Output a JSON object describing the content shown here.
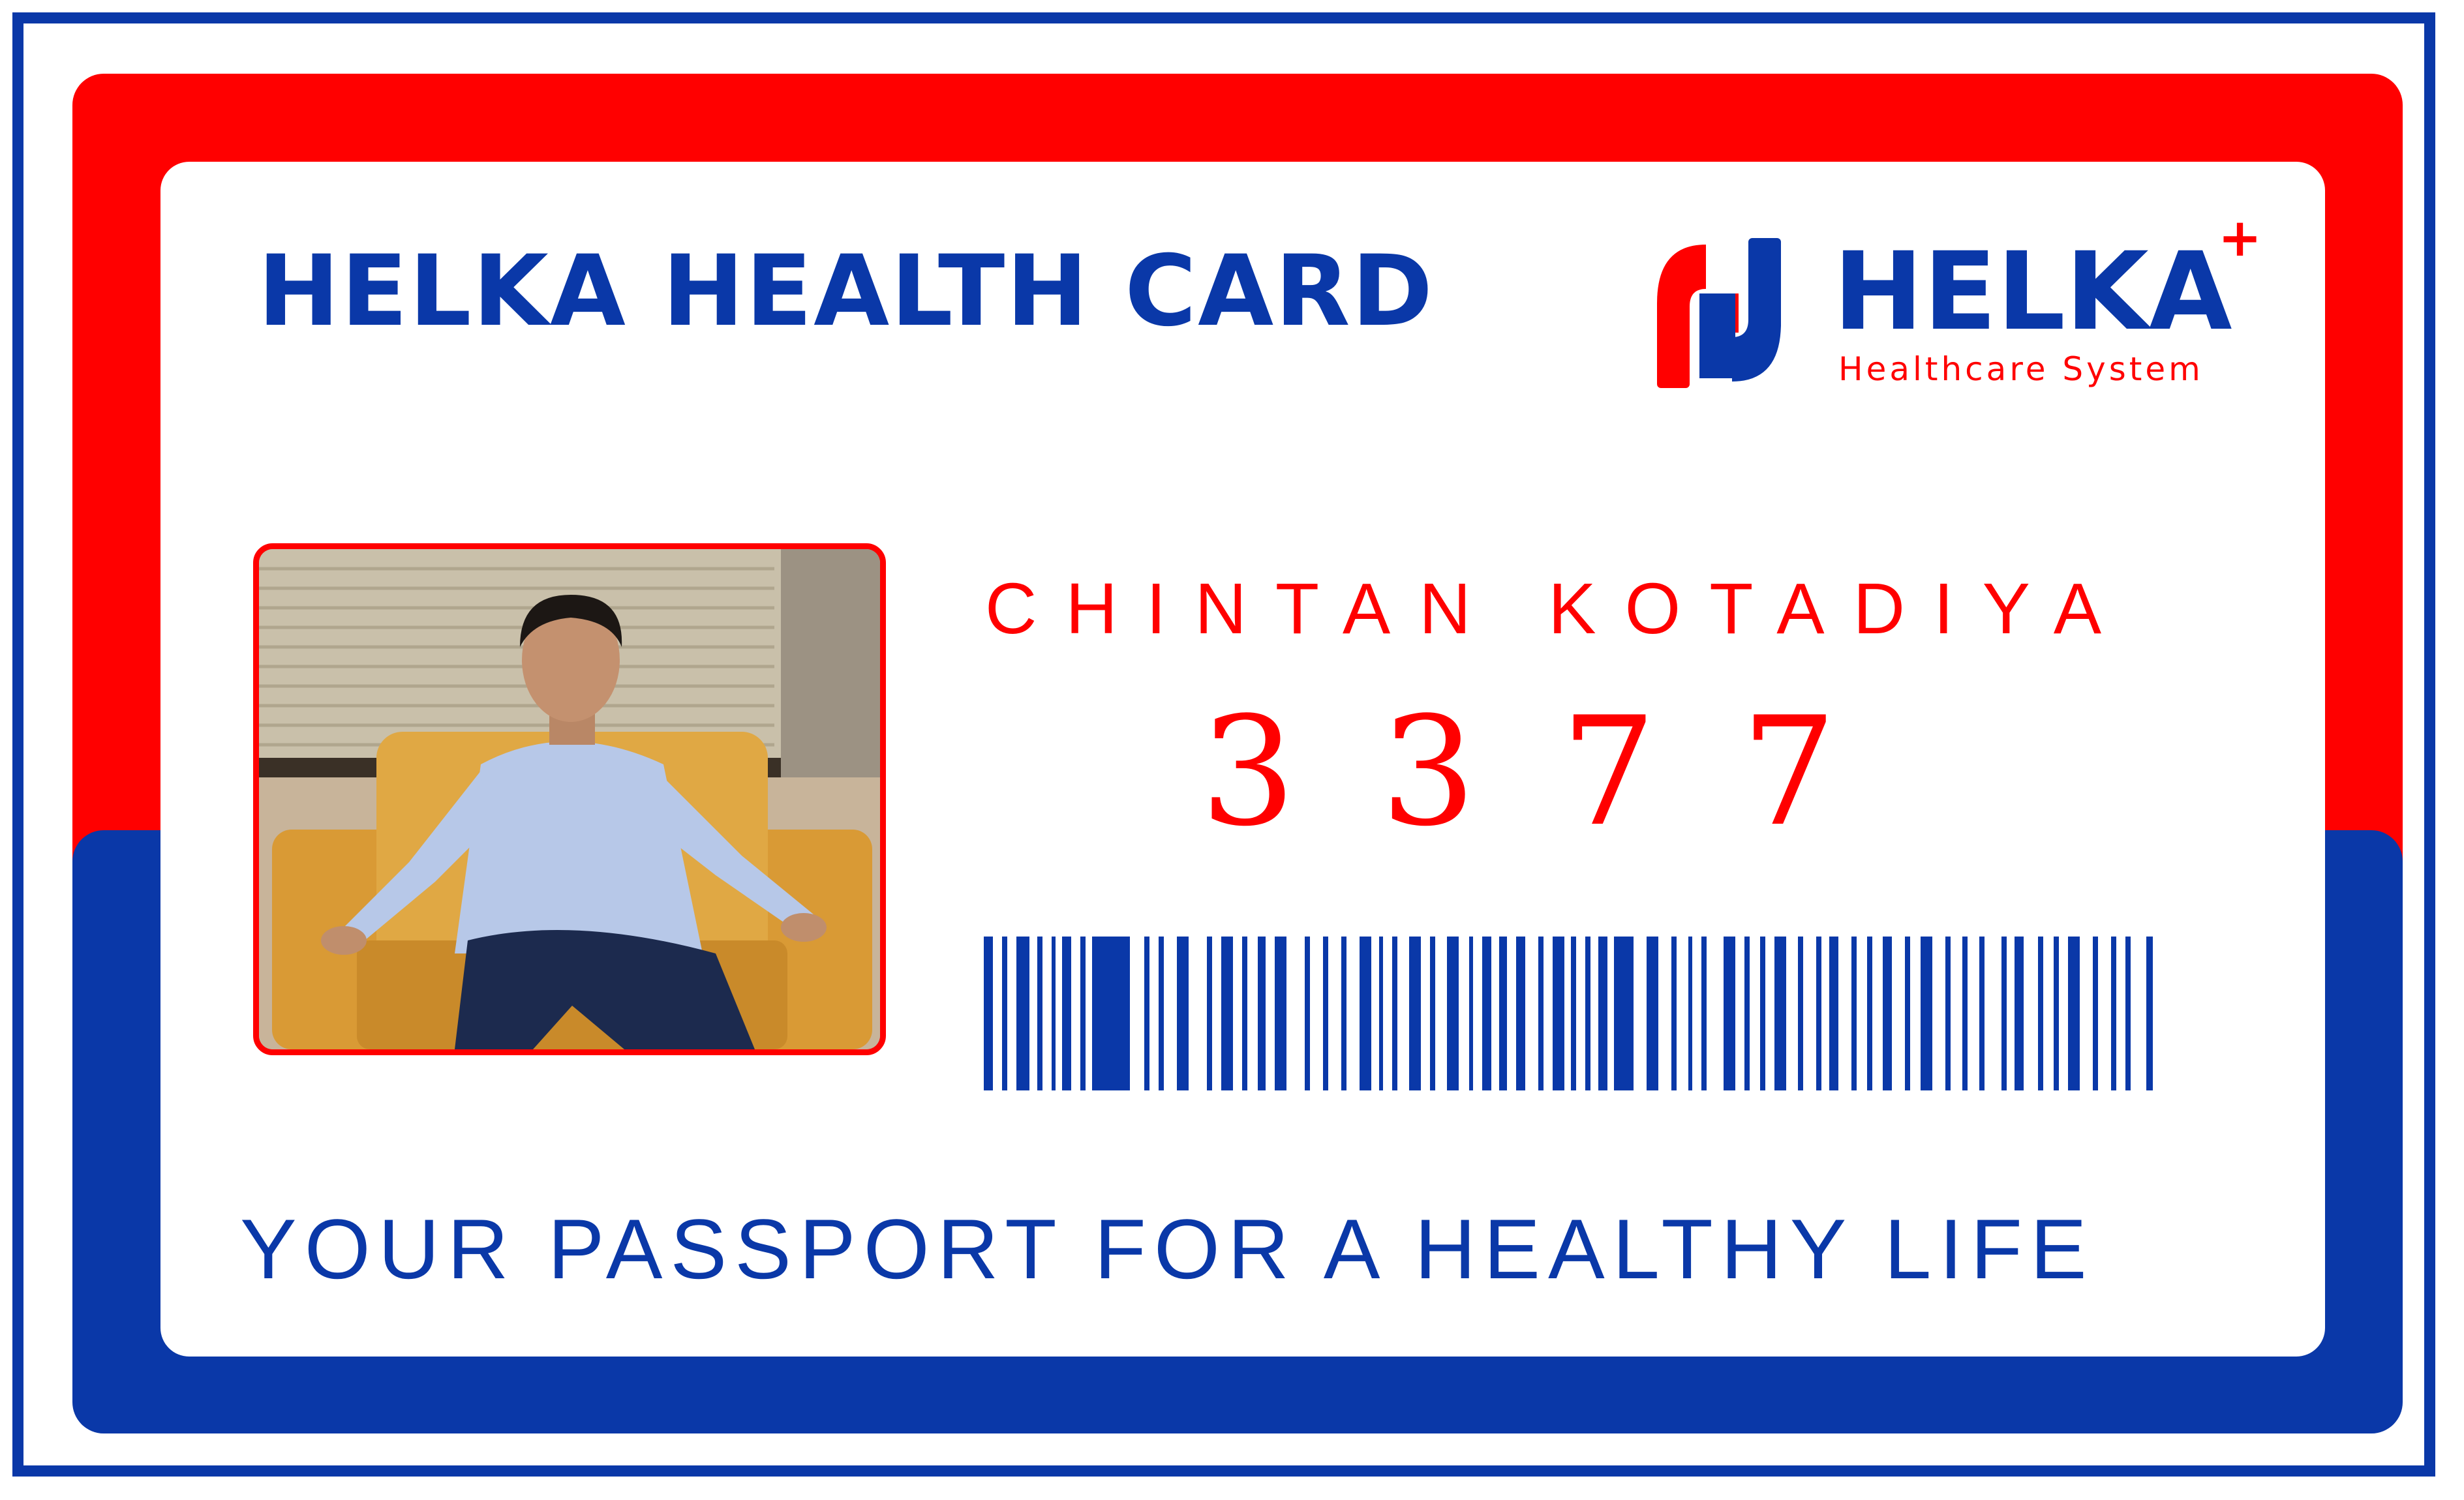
{
  "card": {
    "title": "HELKA HEALTH CARD",
    "member_name": "CHINTAN KOTADIYA",
    "member_number": "3377",
    "motto": "YOUR PASSPORT FOR A HEALTHY LIFE"
  },
  "logo": {
    "wordmark": "HELKA",
    "plus": "+",
    "tagline": "Healthcare System"
  },
  "photo": {
    "subject": "member-portrait"
  },
  "colors": {
    "brand_blue": "#0a38a8",
    "brand_red": "#ff0000",
    "background": "#ffffff"
  }
}
